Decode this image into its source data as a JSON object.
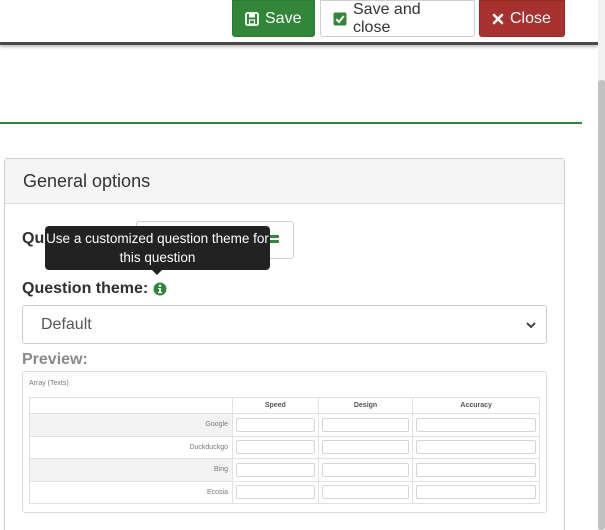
{
  "toolbar": {
    "save_label": "Save",
    "save_close_label": "Save and close",
    "close_label": "Close",
    "save_color": "#328637",
    "close_color": "#a6312e"
  },
  "panel": {
    "heading": "General options",
    "question_label_visible": "Que",
    "tooltip": "Use a customized question theme for this question",
    "theme_label": "Question theme:",
    "theme_select_value": "Default",
    "preview_label": "Preview:"
  },
  "preview": {
    "title": "Array (Texts)",
    "columns": [
      "Speed",
      "Design",
      "Accuracy"
    ],
    "rows": [
      "Google",
      "Duckduckgo",
      "Bing",
      "Ecosia"
    ]
  },
  "icons": {
    "save": "floppy-disk-icon",
    "save_close": "check-square-icon",
    "close": "close-icon",
    "info": "info-circle-icon",
    "chevron": "chevron-down-icon"
  }
}
